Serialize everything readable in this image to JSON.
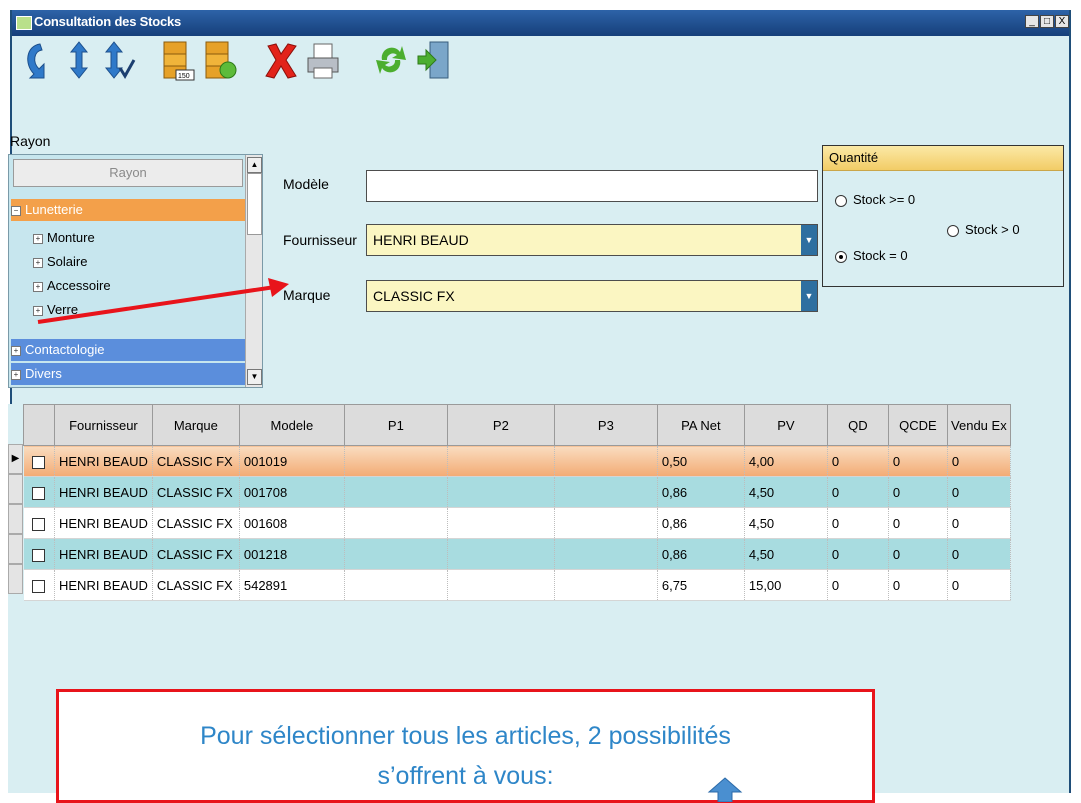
{
  "window": {
    "title": "Consultation des Stocks"
  },
  "toolbar": {
    "icons": [
      "refresh-icon",
      "sort-icon",
      "sort-check-icon",
      "stock-150-icon",
      "stock-refresh-icon",
      "delete-icon",
      "print-icon",
      "recycle-icon",
      "exit-icon"
    ]
  },
  "rayon": {
    "label": "Rayon",
    "header": "Rayon",
    "items": [
      {
        "label": "Lunetterie"
      },
      {
        "label": "Monture"
      },
      {
        "label": "Solaire"
      },
      {
        "label": "Accessoire"
      },
      {
        "label": "Verre"
      },
      {
        "label": "Contactologie"
      },
      {
        "label": "Divers"
      }
    ]
  },
  "form": {
    "modele_label": "Modèle",
    "modele_value": "",
    "fournisseur_label": "Fournisseur",
    "fournisseur_value": "HENRI BEAUD",
    "marque_label": "Marque",
    "marque_value": "CLASSIC FX"
  },
  "quantite": {
    "title": "Quantité",
    "options": [
      "Stock >= 0",
      "Stock > 0",
      "Stock = 0"
    ],
    "selected": "Stock = 0"
  },
  "table": {
    "columns": [
      "Fournisseur",
      "Marque",
      "Modele",
      "P1",
      "P2",
      "P3",
      "PA Net",
      "PV",
      "QD",
      "QCDE",
      "Vendu Ex"
    ],
    "rows": [
      [
        "HENRI BEAUD",
        "CLASSIC FX",
        "001019",
        "",
        "",
        "",
        "0,50",
        "4,00",
        "0",
        "0",
        "0"
      ],
      [
        "HENRI BEAUD",
        "CLASSIC FX",
        "001708",
        "",
        "",
        "",
        "0,86",
        "4,50",
        "0",
        "0",
        "0"
      ],
      [
        "HENRI BEAUD",
        "CLASSIC FX",
        "001608",
        "",
        "",
        "",
        "0,86",
        "4,50",
        "0",
        "0",
        "0"
      ],
      [
        "HENRI BEAUD",
        "CLASSIC FX",
        "001218",
        "",
        "",
        "",
        "0,86",
        "4,50",
        "0",
        "0",
        "0"
      ],
      [
        "HENRI BEAUD",
        "CLASSIC FX",
        "542891",
        "",
        "",
        "",
        "6,75",
        "15,00",
        "0",
        "0",
        "0"
      ]
    ]
  },
  "callout": {
    "line1": "Pour sélectionner tous les articles, 2 possibilités",
    "line2": "s’offrent à vous:"
  },
  "colors": {
    "accent_red": "#e8141b",
    "callout_text": "#2e86c8",
    "selection": "#f3a04a"
  }
}
